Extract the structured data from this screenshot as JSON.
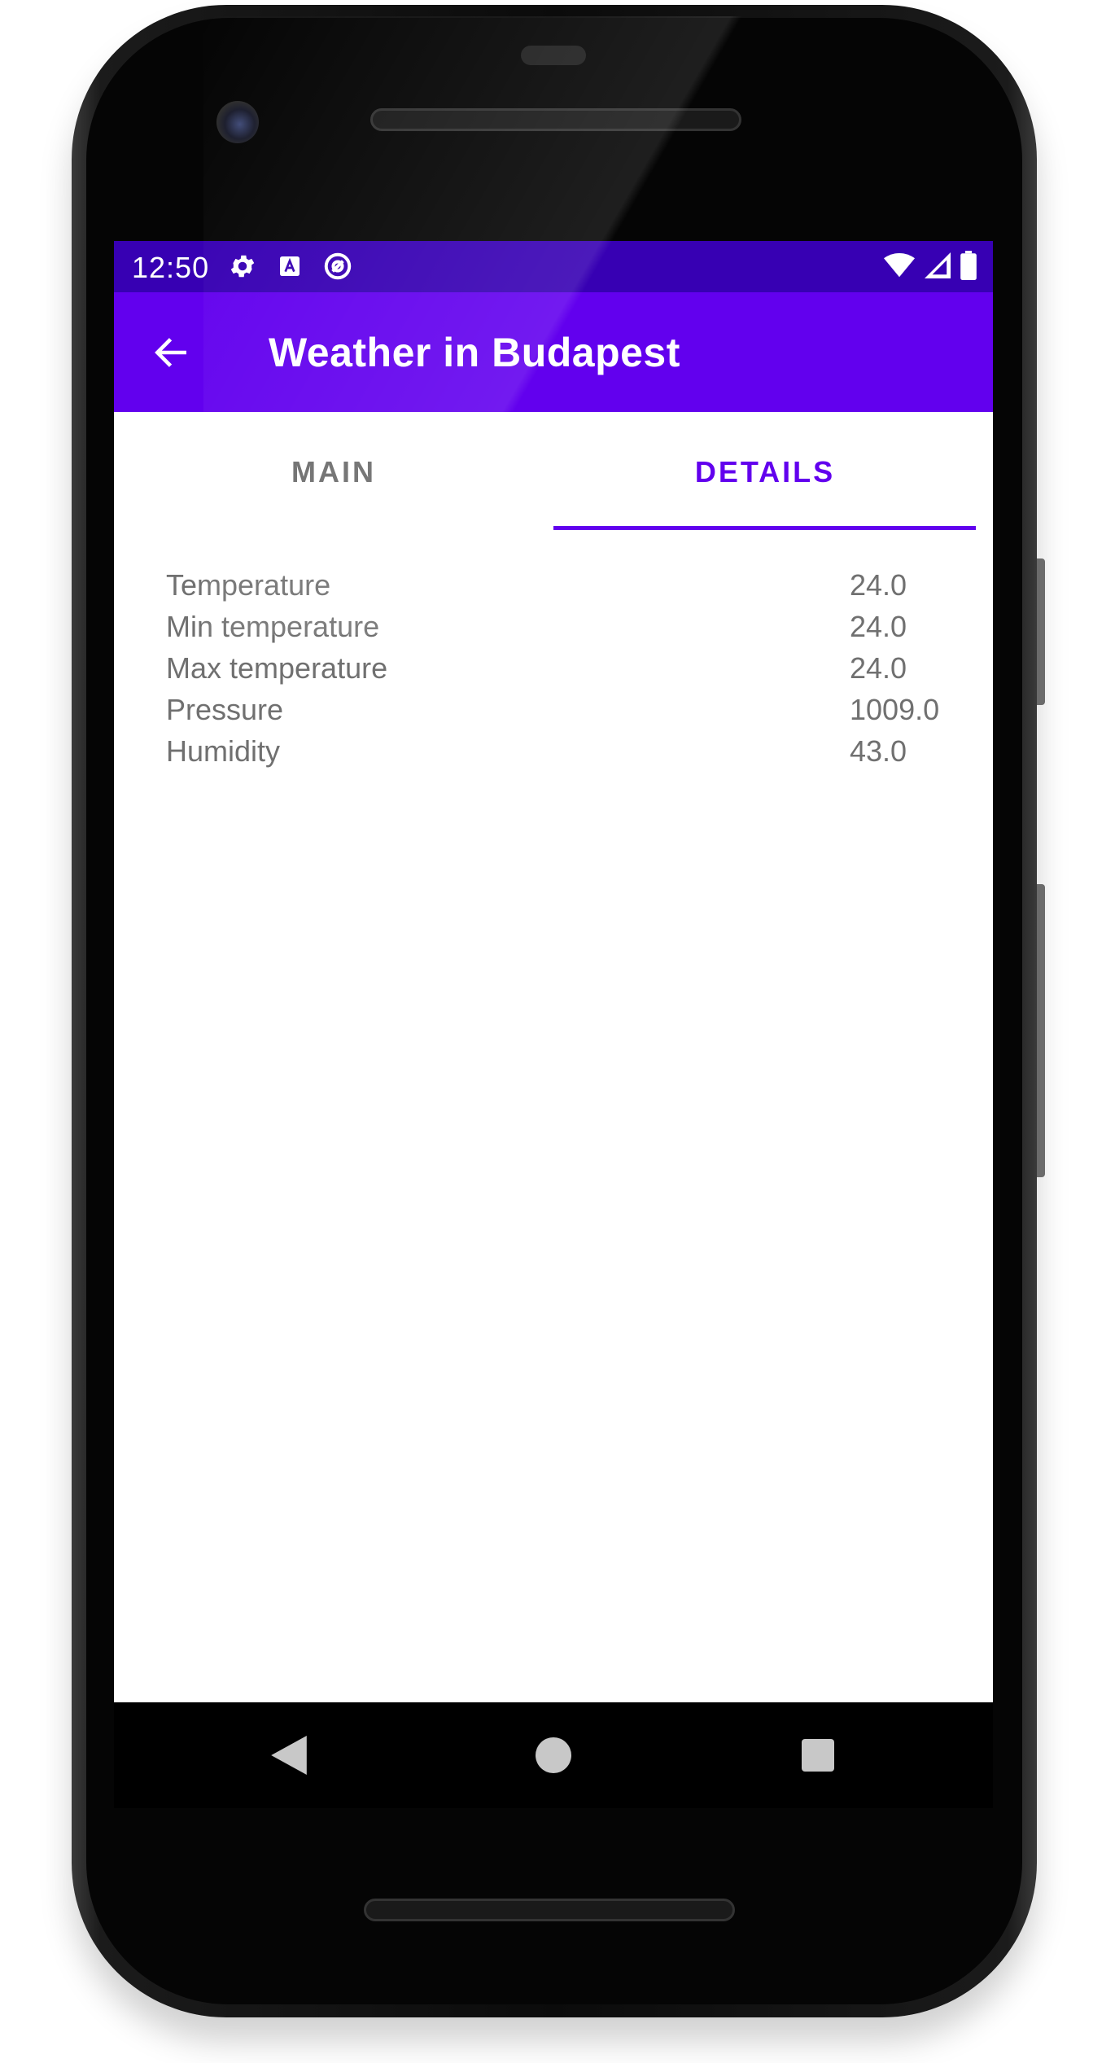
{
  "status_bar": {
    "time": "12:50",
    "left_icons": [
      "gear-icon",
      "keyboard-a-icon",
      "at-sign-icon"
    ],
    "right_icons": [
      "wifi-icon",
      "signal-icon",
      "battery-icon"
    ]
  },
  "app_bar": {
    "title": "Weather in Budapest",
    "back_icon": "arrow-left-icon"
  },
  "tabs": [
    {
      "label": "MAIN",
      "selected": false
    },
    {
      "label": "DETAILS",
      "selected": true
    }
  ],
  "details": [
    {
      "label": "Temperature",
      "value": "24.0"
    },
    {
      "label": "Min temperature",
      "value": "24.0"
    },
    {
      "label": "Max temperature",
      "value": "24.0"
    },
    {
      "label": "Pressure",
      "value": "1009.0"
    },
    {
      "label": "Humidity",
      "value": "43.0"
    }
  ],
  "nav_bar": {
    "buttons": [
      "back-triangle-icon",
      "home-circle-icon",
      "recents-square-icon"
    ]
  },
  "colors": {
    "primary": "#6200ee",
    "primary_dark": "#3700b3",
    "text_secondary": "#707070"
  }
}
